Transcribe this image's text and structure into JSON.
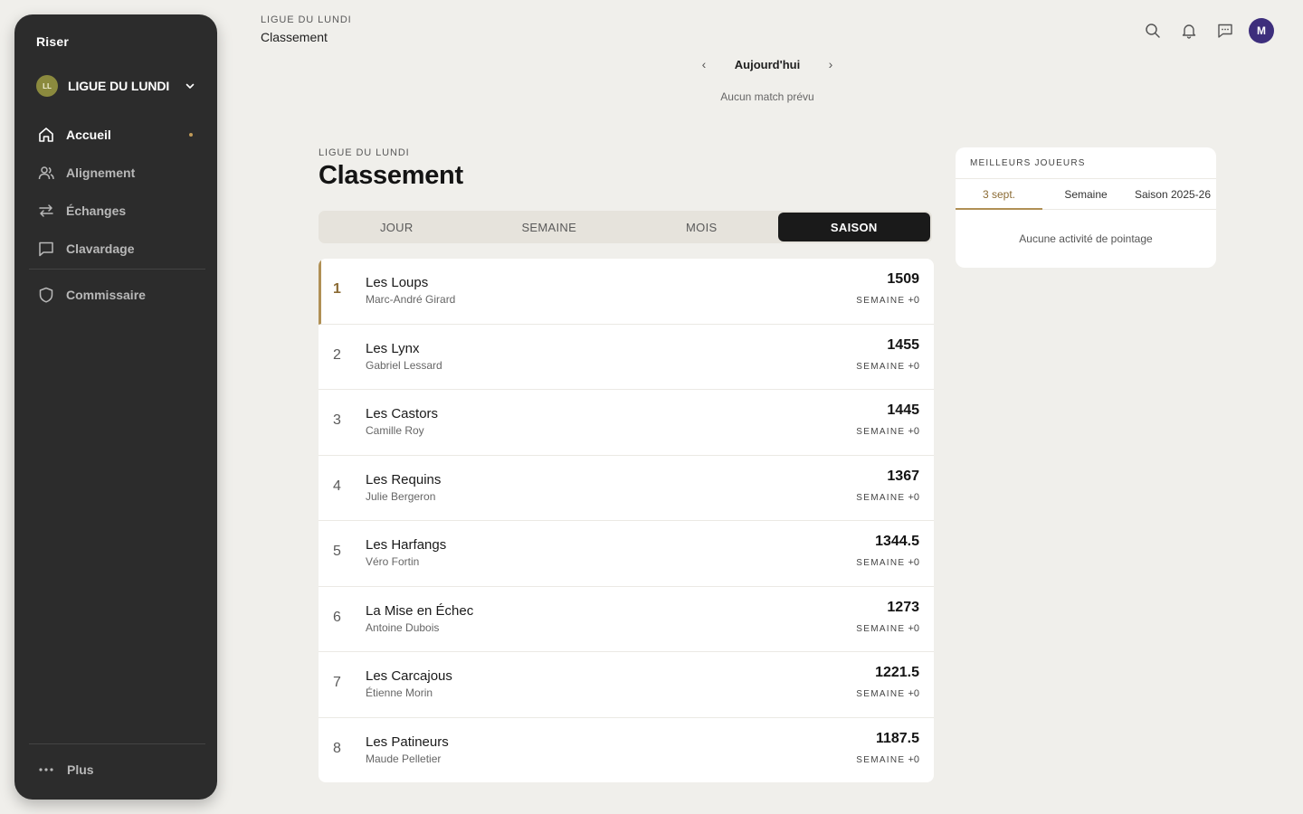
{
  "app": {
    "brand": "Riser"
  },
  "league": {
    "initials": "LL",
    "name": "LIGUE DU LUNDI"
  },
  "nav": {
    "items": [
      {
        "label": "Accueil",
        "icon": "home-icon",
        "active": true
      },
      {
        "label": "Alignement",
        "icon": "users-icon",
        "active": false
      },
      {
        "label": "Échanges",
        "icon": "swap-icon",
        "active": false
      },
      {
        "label": "Clavardage",
        "icon": "chat-icon",
        "active": false
      }
    ],
    "commissioner": {
      "label": "Commissaire",
      "icon": "shield-icon"
    },
    "more": {
      "label": "Plus",
      "icon": "more-icon"
    }
  },
  "header": {
    "overline": "LIGUE DU LUNDI",
    "title": "Classement",
    "user_initial": "M"
  },
  "date_nav": {
    "label": "Aujourd'hui",
    "empty": "Aucun match prévu"
  },
  "page": {
    "overline": "LIGUE DU LUNDI",
    "title": "Classement"
  },
  "period_tabs": [
    {
      "label": "JOUR",
      "active": false
    },
    {
      "label": "SEMAINE",
      "active": false
    },
    {
      "label": "MOIS",
      "active": false
    },
    {
      "label": "SAISON",
      "active": true
    }
  ],
  "standings": [
    {
      "rank": "1",
      "team": "Les Loups",
      "owner": "Marc-André Girard",
      "points": "1509",
      "week_label": "SEMAINE",
      "week_delta": "+0"
    },
    {
      "rank": "2",
      "team": "Les Lynx",
      "owner": "Gabriel Lessard",
      "points": "1455",
      "week_label": "SEMAINE",
      "week_delta": "+0"
    },
    {
      "rank": "3",
      "team": "Les Castors",
      "owner": "Camille Roy",
      "points": "1445",
      "week_label": "SEMAINE",
      "week_delta": "+0"
    },
    {
      "rank": "4",
      "team": "Les Requins",
      "owner": "Julie Bergeron",
      "points": "1367",
      "week_label": "SEMAINE",
      "week_delta": "+0"
    },
    {
      "rank": "5",
      "team": "Les Harfangs",
      "owner": "Véro Fortin",
      "points": "1344.5",
      "week_label": "SEMAINE",
      "week_delta": "+0"
    },
    {
      "rank": "6",
      "team": "La Mise en Échec",
      "owner": "Antoine Dubois",
      "points": "1273",
      "week_label": "SEMAINE",
      "week_delta": "+0"
    },
    {
      "rank": "7",
      "team": "Les Carcajous",
      "owner": "Étienne Morin",
      "points": "1221.5",
      "week_label": "SEMAINE",
      "week_delta": "+0"
    },
    {
      "rank": "8",
      "team": "Les Patineurs",
      "owner": "Maude Pelletier",
      "points": "1187.5",
      "week_label": "SEMAINE",
      "week_delta": "+0"
    }
  ],
  "top_players": {
    "title": "MEILLEURS JOUEURS",
    "tabs": [
      {
        "label": "3 sept.",
        "active": true
      },
      {
        "label": "Semaine",
        "active": false
      },
      {
        "label": "Saison 2025-26",
        "active": false
      }
    ],
    "empty": "Aucune activité de pointage"
  },
  "colors": {
    "sidebar": "#2c2c2c",
    "accent_gold": "#b09055",
    "background": "#f0efeb",
    "avatar_purple": "#3d2e7c",
    "league_avatar": "#8b8a3e"
  }
}
